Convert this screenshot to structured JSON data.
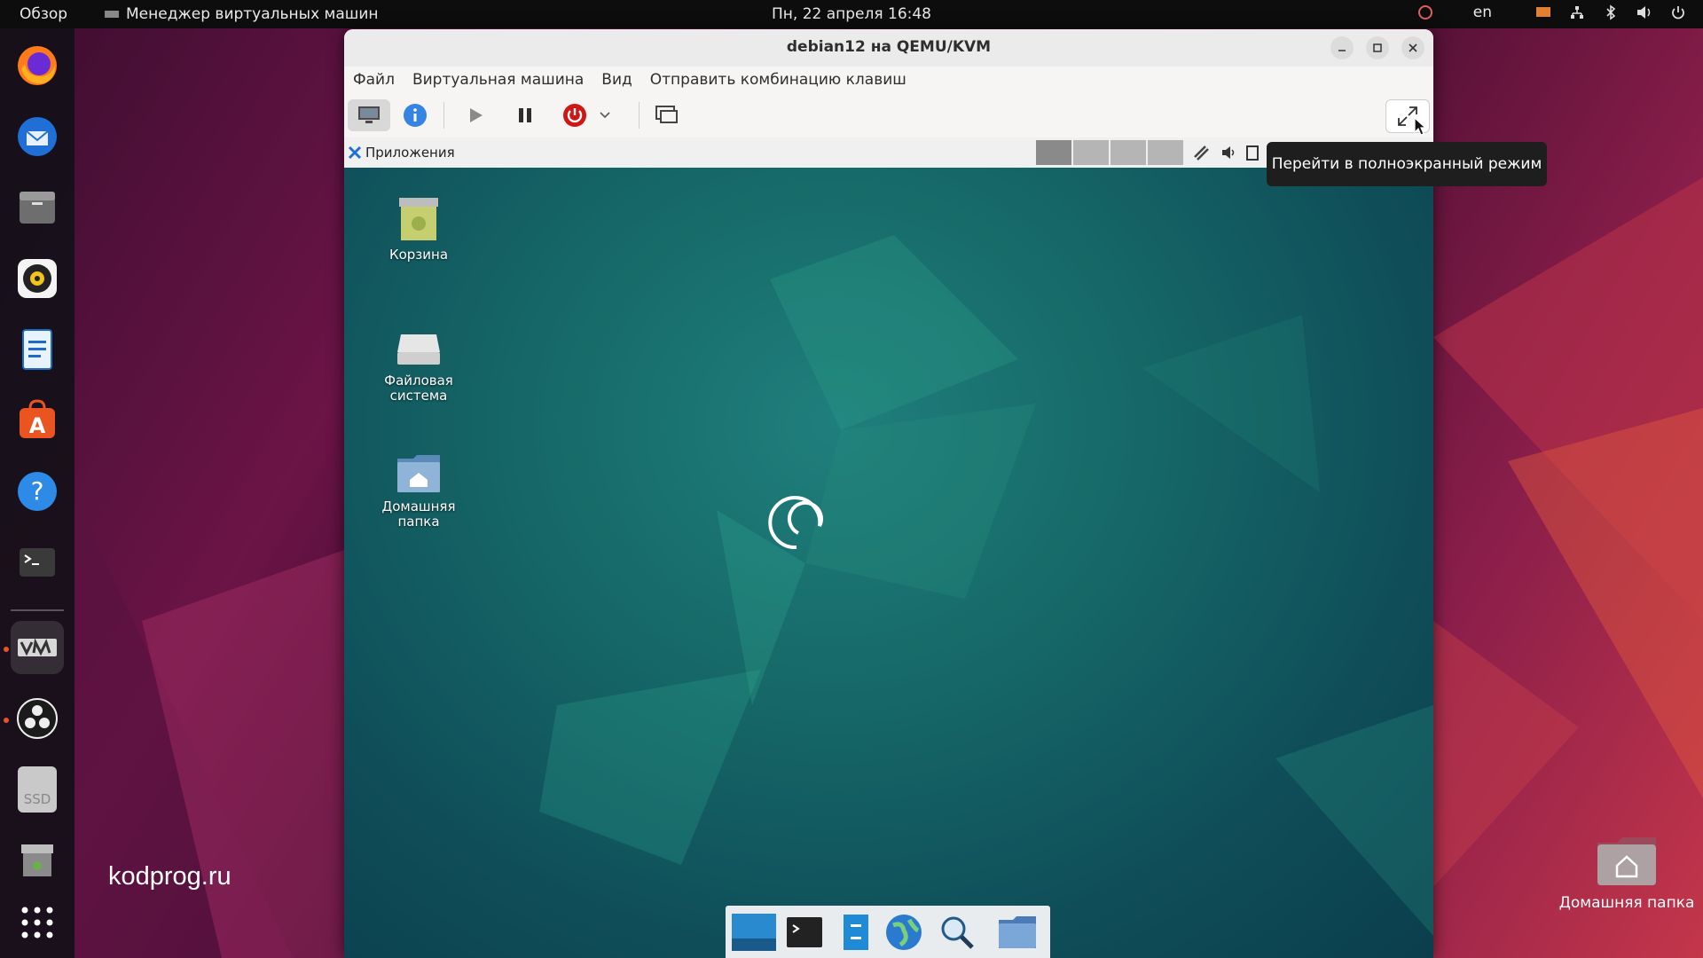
{
  "topbar": {
    "overview": "Обзор",
    "app_name": "Менеджер виртуальных машин",
    "clock": "Пн, 22 апреля  16:48",
    "lang": "en"
  },
  "dock": {
    "items": [
      "firefox-icon",
      "thunderbird-icon",
      "files-icon",
      "rhythmbox-icon",
      "writer-icon",
      "app-center-icon",
      "help-icon",
      "terminal-icon",
      "virt-manager-icon",
      "obs-icon",
      "ssd-drive-icon",
      "trash-icon",
      "show-apps-icon"
    ],
    "ssd_label": "SSD"
  },
  "watermark": "kodprog.ru",
  "desktop": {
    "home_label": "Домашняя папка"
  },
  "window": {
    "title": "debian12 на QEMU/KVM",
    "menu": [
      "Файл",
      "Виртуальная машина",
      "Вид",
      "Отправить комбинацию клавиш"
    ]
  },
  "guest": {
    "panel_apps": "Приложения",
    "icons": {
      "trash": "Корзина",
      "filesystem": "Файловая система",
      "home": "Домашняя папка"
    }
  },
  "tooltip": "Перейти в полноэкранный режим",
  "colors": {
    "accent": "#e95420",
    "shutdown": "#d01716",
    "info": "#3584e4"
  }
}
